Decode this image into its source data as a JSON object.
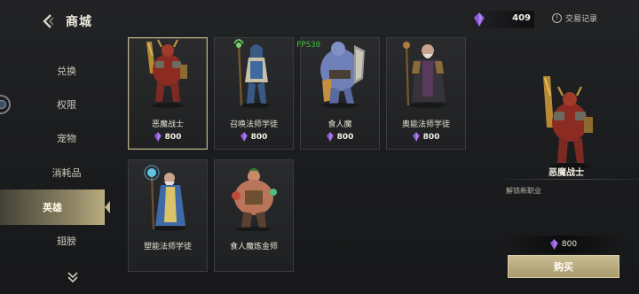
{
  "header": {
    "title": "商城",
    "currency_value": "409",
    "history_label": "交易记录"
  },
  "sidebar": {
    "items": [
      {
        "label": "兑换"
      },
      {
        "label": "权限"
      },
      {
        "label": "宠物"
      },
      {
        "label": "消耗品"
      },
      {
        "label": "英雄",
        "active": true
      },
      {
        "label": "翅膀"
      }
    ]
  },
  "products": [
    {
      "name": "恶魔战士",
      "price": "800",
      "icon": "demon-warrior-icon"
    },
    {
      "name": "召唤法师学徒",
      "price": "800",
      "icon": "summoner-apprentice-icon"
    },
    {
      "name": "食人魔",
      "price": "800",
      "icon": "ogre-icon"
    },
    {
      "name": "奥能法师学徒",
      "price": "800",
      "icon": "arcane-apprentice-icon"
    },
    {
      "name": "塑能法师学徒",
      "price": "",
      "icon": "evoker-apprentice-icon"
    },
    {
      "name": "食人魔炼金师",
      "price": "",
      "icon": "ogre-alchemist-icon"
    }
  ],
  "overlay": {
    "fps_label": "FPS30"
  },
  "detail": {
    "name": "恶魔战士",
    "description": "解锁新职业",
    "price": "800",
    "buy_label": "购买"
  },
  "colors": {
    "accent_gold": "#c4b78c",
    "gem_purple": "#8f5bd8"
  }
}
